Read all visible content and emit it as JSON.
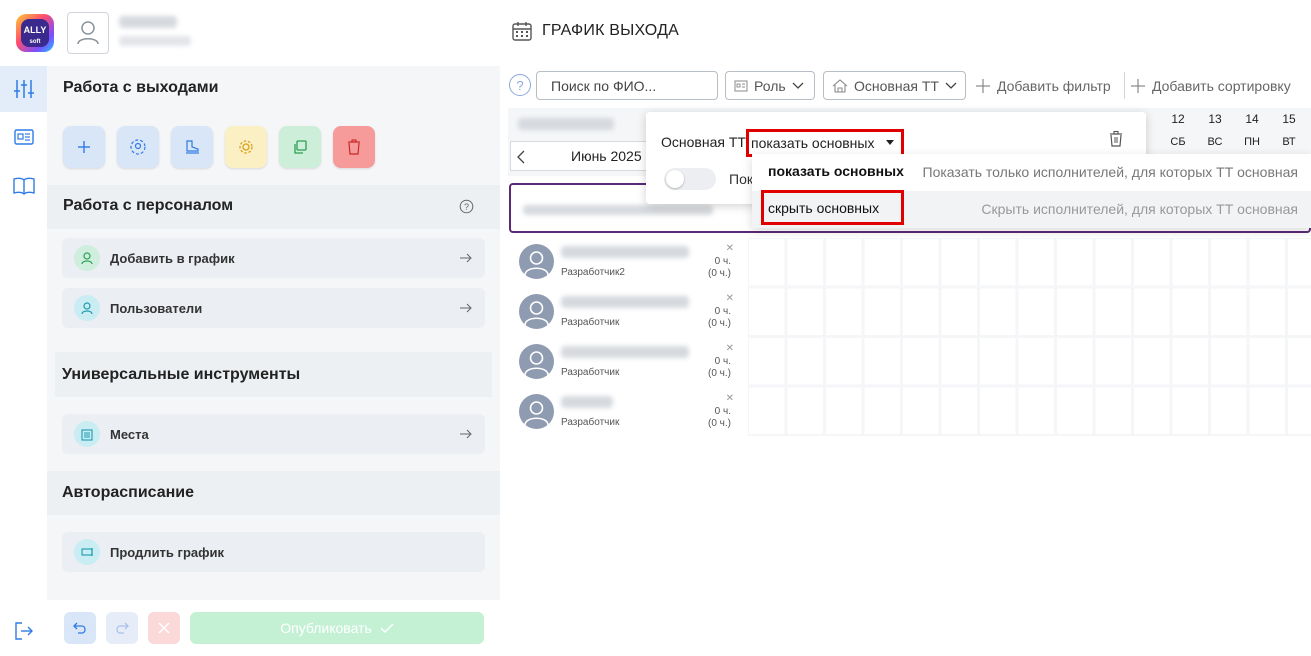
{
  "app": {
    "logo_text": "ALLY",
    "logo_sub": "soft",
    "title": "ГРАФИК ВЫХОДА"
  },
  "sidebar": {
    "section_outputs": "Работа с выходами",
    "section_staff": "Работа с персоналом",
    "staff_items": [
      {
        "label": "Добавить в график",
        "icon": "add-user-icon"
      },
      {
        "label": "Пользователи",
        "icon": "users-icon"
      }
    ],
    "section_tools": "Универсальные инструменты",
    "tools_items": [
      {
        "label": "Места",
        "icon": "building-icon"
      }
    ],
    "section_auto": "Авторасписание",
    "auto_items": [
      {
        "label": "Продлить график",
        "icon": "extend-icon"
      }
    ],
    "publish_label": "Опубликовать"
  },
  "toolbar": {
    "help": "?",
    "search_placeholder": "Поиск по ФИО...",
    "role_label": "Роль",
    "main_tt_label": "Основная ТТ",
    "add_filter": "Добавить фильтр",
    "add_sort": "Добавить сортировку"
  },
  "schedule": {
    "month": "Июнь 2025",
    "days": [
      {
        "num": "12",
        "wd": "СБ"
      },
      {
        "num": "13",
        "wd": "ВС"
      },
      {
        "num": "14",
        "wd": "ПН"
      },
      {
        "num": "15",
        "wd": "ВТ"
      }
    ],
    "employees": [
      {
        "role": "Разработчик2",
        "hours": "0 ч.",
        "hours_sub": "(0 ч.)"
      },
      {
        "role": "Разработчик",
        "hours": "0 ч.",
        "hours_sub": "(0 ч.)"
      },
      {
        "role": "Разработчик",
        "hours": "0 ч.",
        "hours_sub": "(0 ч.)"
      },
      {
        "role": "Разработчик",
        "hours": "0 ч.",
        "hours_sub": "(0 ч.)"
      }
    ]
  },
  "filter_popup": {
    "label": "Основная ТТ",
    "selected": "показать основных",
    "toggle_label": "Пок",
    "options": [
      {
        "title": "показать основных",
        "desc": "Показать только исполнителей, для которых ТТ основная"
      },
      {
        "title": "скрыть основных",
        "desc": "Скрыть исполнителей, для которых ТТ основная"
      }
    ]
  },
  "colors": {
    "accent": "#2f7be5",
    "highlight": "#e00000",
    "group_border": "#5a2a76"
  }
}
